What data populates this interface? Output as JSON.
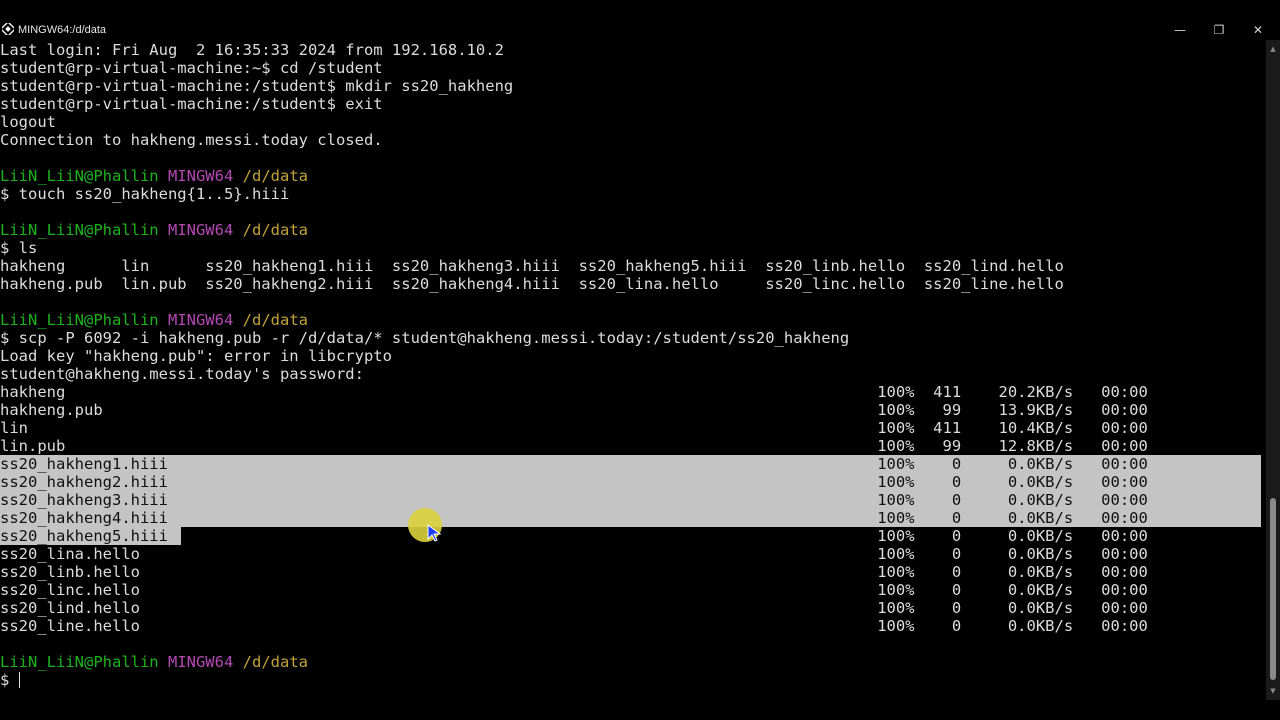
{
  "window": {
    "title": "MINGW64:/d/data",
    "minimize_glyph": "—",
    "maximize_glyph": "❐",
    "close_glyph": "✕",
    "icon": "mingw-app-icon"
  },
  "terminal": {
    "lines": [
      {
        "segments": [
          {
            "text": "Last login: Fri Aug  2 16:35:33 2024 from 192.168.10.2",
            "color": "default"
          }
        ]
      },
      {
        "segments": [
          {
            "text": "student@rp-virtual-machine:~$ cd /student",
            "color": "default"
          }
        ]
      },
      {
        "segments": [
          {
            "text": "student@rp-virtual-machine:/student$ mkdir ss20_hakheng",
            "color": "default"
          }
        ]
      },
      {
        "segments": [
          {
            "text": "student@rp-virtual-machine:/student$ exit",
            "color": "default"
          }
        ]
      },
      {
        "segments": [
          {
            "text": "logout",
            "color": "default"
          }
        ]
      },
      {
        "segments": [
          {
            "text": "Connection to hakheng.messi.today closed.",
            "color": "default"
          }
        ]
      },
      {
        "segments": []
      },
      {
        "segments": [
          {
            "text": "LiiN_LiiN@Phallin",
            "color": "green"
          },
          {
            "text": " ",
            "color": "default"
          },
          {
            "text": "MINGW64",
            "color": "purple"
          },
          {
            "text": " ",
            "color": "default"
          },
          {
            "text": "/d/data",
            "color": "yellow"
          }
        ]
      },
      {
        "segments": [
          {
            "text": "$ touch ss20_hakheng{1..5}.hiii",
            "color": "default"
          }
        ]
      },
      {
        "segments": []
      },
      {
        "segments": [
          {
            "text": "LiiN_LiiN@Phallin",
            "color": "green"
          },
          {
            "text": " ",
            "color": "default"
          },
          {
            "text": "MINGW64",
            "color": "purple"
          },
          {
            "text": " ",
            "color": "default"
          },
          {
            "text": "/d/data",
            "color": "yellow"
          }
        ]
      },
      {
        "segments": [
          {
            "text": "$ ls",
            "color": "default"
          }
        ]
      },
      {
        "segments": [
          {
            "text": "hakheng      lin      ss20_hakheng1.hiii  ss20_hakheng3.hiii  ss20_hakheng5.hiii  ss20_linb.hello  ss20_lind.hello",
            "color": "default"
          }
        ]
      },
      {
        "segments": [
          {
            "text": "hakheng.pub  lin.pub  ss20_hakheng2.hiii  ss20_hakheng4.hiii  ss20_lina.hello     ss20_linc.hello  ss20_line.hello",
            "color": "default"
          }
        ]
      },
      {
        "segments": []
      },
      {
        "segments": [
          {
            "text": "LiiN_LiiN@Phallin",
            "color": "green"
          },
          {
            "text": " ",
            "color": "default"
          },
          {
            "text": "MINGW64",
            "color": "purple"
          },
          {
            "text": " ",
            "color": "default"
          },
          {
            "text": "/d/data",
            "color": "yellow"
          }
        ]
      },
      {
        "segments": [
          {
            "text": "$ scp -P 6092 -i hakheng.pub -r /d/data/* student@hakheng.messi.today:/student/ss20_hakheng",
            "color": "default"
          }
        ]
      },
      {
        "segments": [
          {
            "text": "Load key \"hakheng.pub\": error in libcrypto",
            "color": "default"
          }
        ]
      },
      {
        "segments": [
          {
            "text": "student@hakheng.messi.today's password:",
            "color": "default"
          }
        ]
      },
      {
        "segments": [
          {
            "text": "hakheng                                                                                       100%  411    20.2KB/s   00:00",
            "color": "default"
          }
        ]
      },
      {
        "segments": [
          {
            "text": "hakheng.pub                                                                                   100%   99    13.9KB/s   00:00",
            "color": "default"
          }
        ]
      },
      {
        "segments": [
          {
            "text": "lin                                                                                           100%  411    10.4KB/s   00:00",
            "color": "default"
          }
        ]
      },
      {
        "segments": [
          {
            "text": "lin.pub                                                                                       100%   99    12.8KB/s   00:00",
            "color": "default"
          }
        ]
      },
      {
        "selected": true,
        "segments": [
          {
            "text": "ss20_hakheng1.hiii                                                                            100%    0     0.0KB/s   00:00",
            "color": "dark"
          }
        ]
      },
      {
        "selected": true,
        "segments": [
          {
            "text": "ss20_hakheng2.hiii                                                                            100%    0     0.0KB/s   00:00",
            "color": "dark"
          }
        ]
      },
      {
        "selected": true,
        "segments": [
          {
            "text": "ss20_hakheng3.hiii                                                                            100%    0     0.0KB/s   00:00",
            "color": "dark"
          }
        ]
      },
      {
        "selected": true,
        "segments": [
          {
            "text": "ss20_hakheng4.hiii                                                                            100%    0     0.0KB/s   00:00",
            "color": "dark"
          }
        ]
      },
      {
        "selected_partial": true,
        "segments": [
          {
            "text": "ss20_hakheng5.hiii",
            "color": "dark"
          },
          {
            "text": "                                                                            100%    0     0.0KB/s   00:00",
            "color": "default"
          }
        ]
      },
      {
        "segments": [
          {
            "text": "ss20_lina.hello                                                                               100%    0     0.0KB/s   00:00",
            "color": "default"
          }
        ]
      },
      {
        "segments": [
          {
            "text": "ss20_linb.hello                                                                               100%    0     0.0KB/s   00:00",
            "color": "default"
          }
        ]
      },
      {
        "segments": [
          {
            "text": "ss20_linc.hello                                                                               100%    0     0.0KB/s   00:00",
            "color": "default"
          }
        ]
      },
      {
        "segments": [
          {
            "text": "ss20_lind.hello                                                                               100%    0     0.0KB/s   00:00",
            "color": "default"
          }
        ]
      },
      {
        "segments": [
          {
            "text": "ss20_line.hello                                                                               100%    0     0.0KB/s   00:00",
            "color": "default"
          }
        ]
      },
      {
        "segments": []
      },
      {
        "segments": [
          {
            "text": "LiiN_LiiN@Phallin",
            "color": "green"
          },
          {
            "text": " ",
            "color": "default"
          },
          {
            "text": "MINGW64",
            "color": "purple"
          },
          {
            "text": " ",
            "color": "default"
          },
          {
            "text": "/d/data",
            "color": "yellow"
          }
        ]
      },
      {
        "segments": [
          {
            "text": "$ ",
            "color": "default"
          }
        ],
        "cursor": true
      }
    ]
  },
  "colors": {
    "background": "#000000",
    "default_text": "#dcdcdc",
    "prompt_user": "#1eb31e",
    "prompt_env": "#b347b3",
    "prompt_path": "#c2a23a",
    "selection": "#c4c4c4",
    "mouse_highlight": "#dcd23c"
  },
  "scrollbar": {
    "up_glyph": "▲",
    "down_glyph": "▼"
  }
}
